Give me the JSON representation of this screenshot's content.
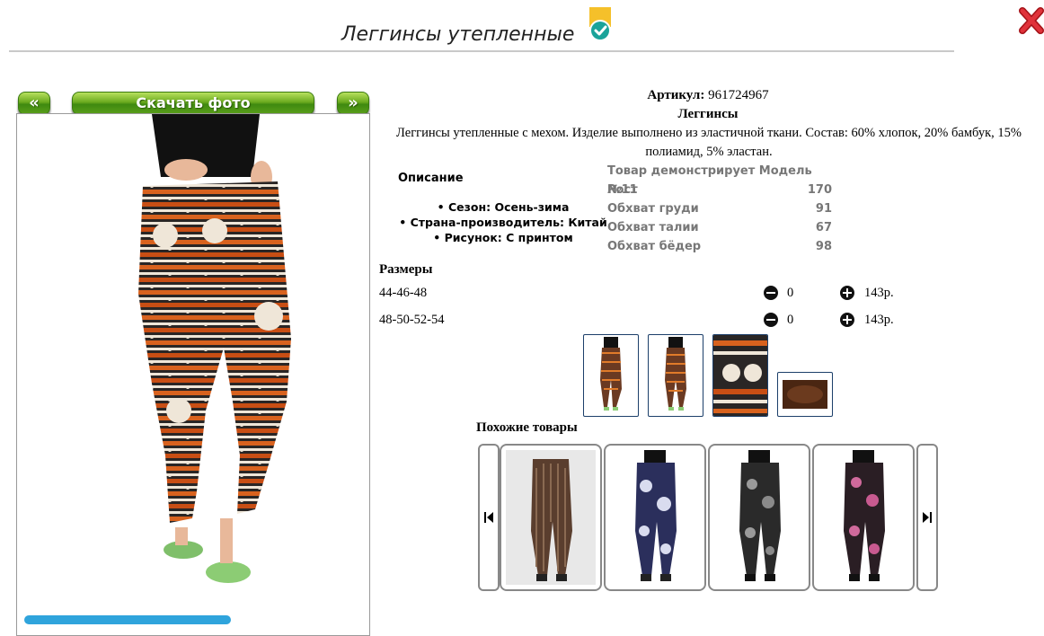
{
  "header": {
    "title": "Леггинсы утепленные",
    "verified_icon": "verified-badge-icon",
    "close_icon": "close-icon"
  },
  "gallery": {
    "prev_label": "«",
    "download_label": "Скачать фото",
    "next_label": "»"
  },
  "product": {
    "article_label": "Артикул:",
    "article_value": "961724967",
    "type": "Леггинсы",
    "description": "Леггинсы утепленные с мехом. Изделие выполнено из эластичной ткани. Состав: 60% хлопок, 20% бамбук, 15% полиамид, 5% эластан."
  },
  "description_block": {
    "title": "Описание",
    "attributes": [
      "Сезон: Осень-зима",
      "Страна-производитель: Китай",
      "Рисунок: С принтом"
    ]
  },
  "model": {
    "title": "Товар демонстрирует Модель №11",
    "rows": [
      {
        "label": "Рост",
        "value": "170"
      },
      {
        "label": "Обхват груди",
        "value": "91"
      },
      {
        "label": "Обхват талии",
        "value": "67"
      },
      {
        "label": "Обхват бёдер",
        "value": "98"
      }
    ]
  },
  "sizes": {
    "title": "Размеры",
    "rows": [
      {
        "size": "44-46-48",
        "qty": "0",
        "price": "143р."
      },
      {
        "size": "48-50-52-54",
        "qty": "0",
        "price": "143р."
      }
    ]
  },
  "similar": {
    "title": "Похожие товары",
    "prev_icon": "first-arrow-icon",
    "next_icon": "last-arrow-icon"
  },
  "colors": {
    "accent_green": "#5a9e1a",
    "thumb_border": "#1c3f6a",
    "close_red": "#d0242a"
  }
}
